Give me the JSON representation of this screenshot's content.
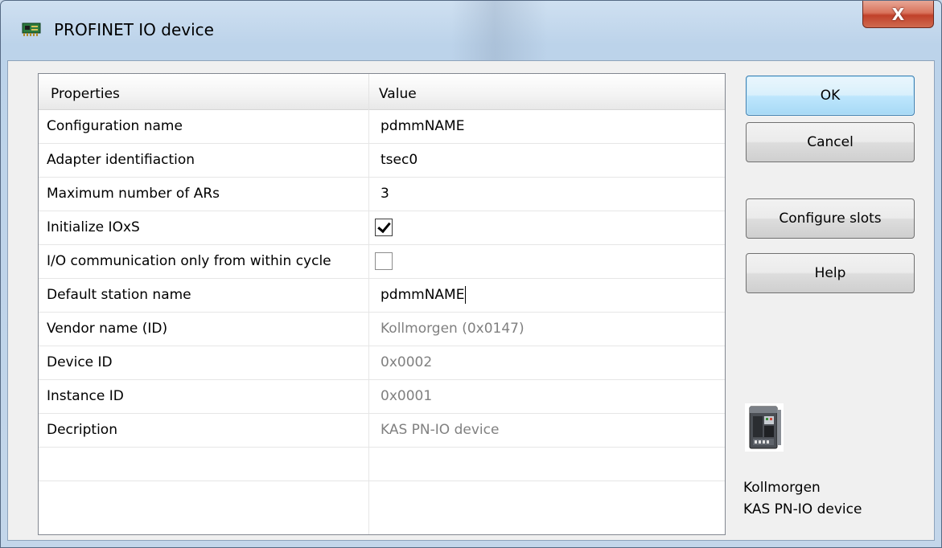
{
  "window": {
    "title": "PROFINET IO device",
    "close_label": "X"
  },
  "grid": {
    "headers": {
      "properties": "Properties",
      "value": "Value"
    },
    "rows": [
      {
        "name": "Configuration name",
        "value": "pdmmNAME"
      },
      {
        "name": "Adapter identifiaction",
        "value": "tsec0"
      },
      {
        "name": "Maximum number of ARs",
        "value": "3"
      },
      {
        "name": "Initialize IOxS",
        "checked": true
      },
      {
        "name": "I/O communication only from within cycle",
        "checked": false
      },
      {
        "name": "Default station name",
        "value": "pdmmNAME"
      },
      {
        "name": "Vendor name (ID)",
        "value": "Kollmorgen (0x0147)"
      },
      {
        "name": "Device ID",
        "value": "0x0002"
      },
      {
        "name": "Instance ID",
        "value": "0x0001"
      },
      {
        "name": "Decription",
        "value": "KAS PN-IO device"
      }
    ]
  },
  "buttons": {
    "ok": "OK",
    "cancel": "Cancel",
    "configure_slots": "Configure slots",
    "help": "Help"
  },
  "device_info": {
    "vendor": "Kollmorgen",
    "device": "KAS PN-IO device"
  },
  "icons": {
    "app": "network-adapter-icon",
    "device": "drive-device-image"
  },
  "colors": {
    "accent": "#3c7fb1",
    "close": "#c0412a",
    "readonly_text": "#808080"
  }
}
